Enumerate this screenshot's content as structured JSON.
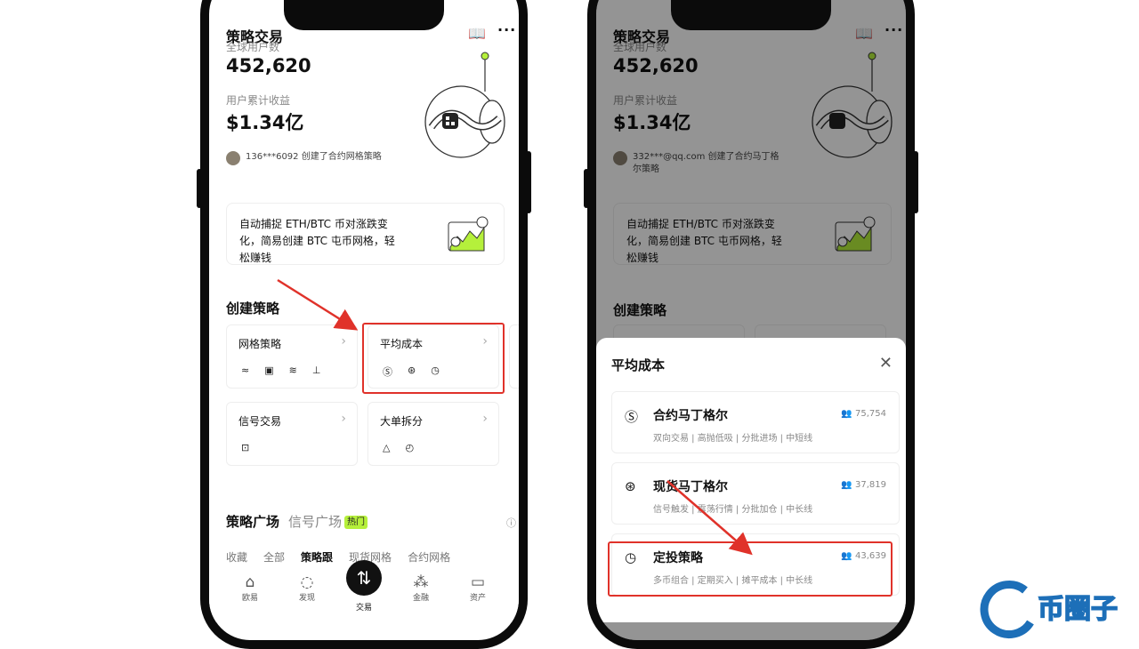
{
  "left": {
    "title": "策略交易",
    "global_users_label": "全球用户数",
    "global_users_value": "452,620",
    "earnings_label": "用户累计收益",
    "earnings_value": "$1.34亿",
    "feed_text": "136***6092 创建了合约网格策略",
    "banner_text": "自动捕捉 ETH/BTC 币对涨跌变化，简易创建 BTC 屯币网格，轻松赚钱",
    "create_title": "创建策略",
    "cards": [
      {
        "title": "网格策略",
        "icons": [
          "≈",
          "▣",
          "≋",
          "⊥"
        ]
      },
      {
        "title": "平均成本",
        "icons": [
          "Ⓢ",
          "⊛",
          "◷"
        ]
      },
      {
        "title": "信号交易",
        "icons": [
          "⊡"
        ]
      },
      {
        "title": "大单拆分",
        "icons": [
          "△",
          "◴"
        ]
      }
    ],
    "tab_main": "策略广场",
    "tab_signal": "信号广场",
    "hot_badge": "热门",
    "subtabs": [
      "收藏",
      "全部",
      "策略跟",
      "现货网格",
      "合约网格"
    ],
    "nav": [
      "欧易",
      "发现",
      "交易",
      "金融",
      "资产"
    ]
  },
  "right": {
    "title": "策略交易",
    "global_users_label": "全球用户数",
    "global_users_value": "452,620",
    "earnings_label": "用户累计收益",
    "earnings_value": "$1.34亿",
    "feed_text": "332***@qq.com 创建了合约马丁格尔策略",
    "banner_text": "自动捕捉 ETH/BTC 币对涨跌变化，简易创建 BTC 屯币网格，轻松赚钱",
    "create_title": "创建策略",
    "sheet_title": "平均成本",
    "options": [
      {
        "name": "合约马丁格尔",
        "users": "75,754",
        "tags": "双向交易 | 高抛低吸 | 分批进场 | 中短线",
        "icon": "Ⓢ"
      },
      {
        "name": "现货马丁格尔",
        "users": "37,819",
        "tags": "信号触发 | 震荡行情 | 分批加仓 | 中长线",
        "icon": "⊛"
      },
      {
        "name": "定投策略",
        "users": "43,639",
        "tags": "多币组合 | 定期买入 | 摊平成本 | 中长线",
        "icon": "◷"
      }
    ]
  },
  "watermark": "币圈子",
  "colors": {
    "highlight": "#e0322a",
    "hot": "#b5f03b",
    "watermark": "#1d6fb8"
  }
}
